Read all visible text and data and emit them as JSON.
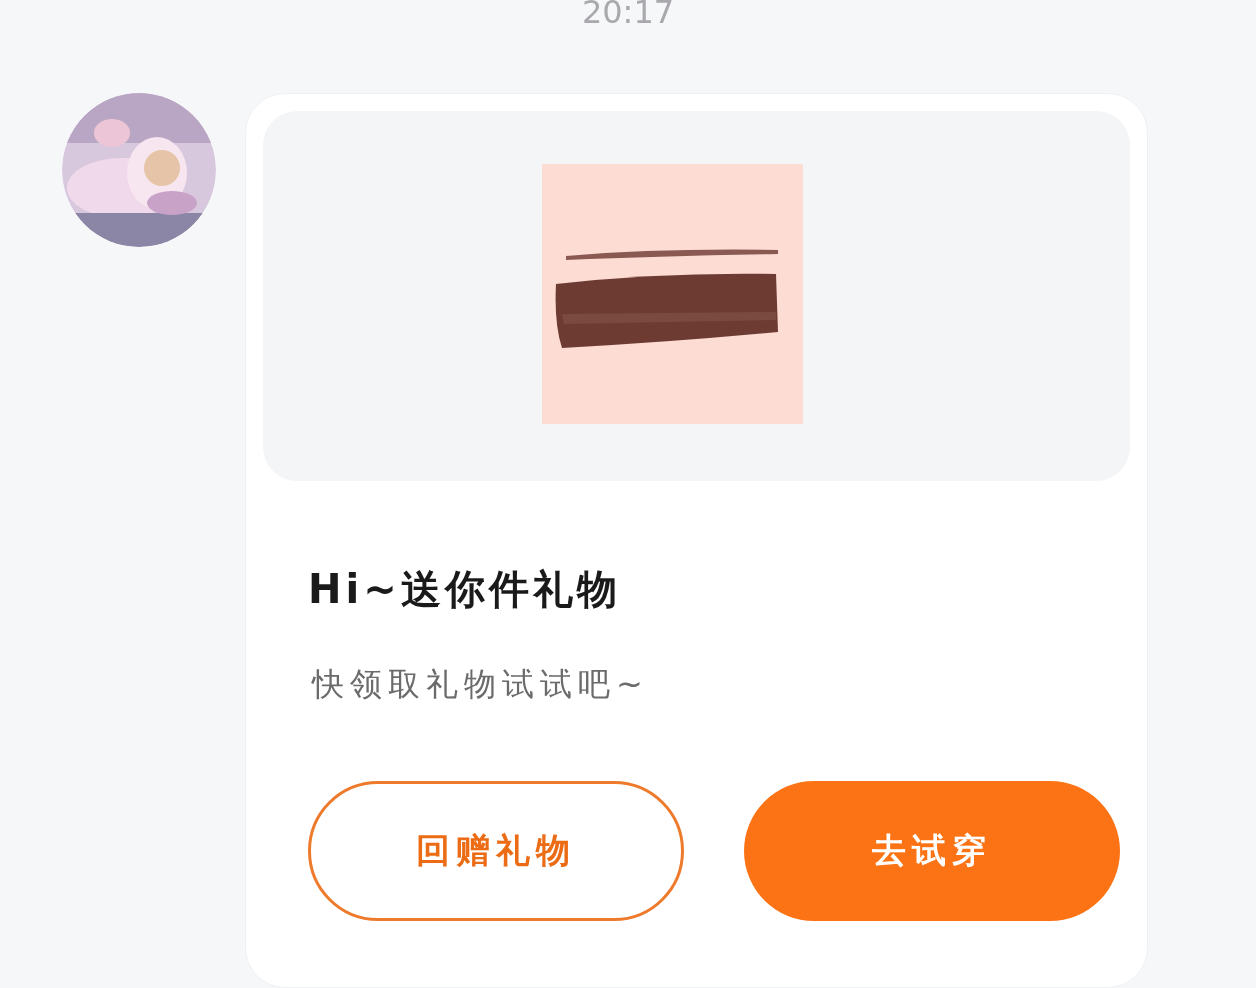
{
  "time": "20:17",
  "message": {
    "title": "Hi~送你件礼物",
    "subtitle": "快领取礼物试试吧~",
    "buttons": [
      {
        "label": "回赠礼物",
        "kind": "outline"
      },
      {
        "label": "去试穿",
        "kind": "primary"
      }
    ]
  }
}
